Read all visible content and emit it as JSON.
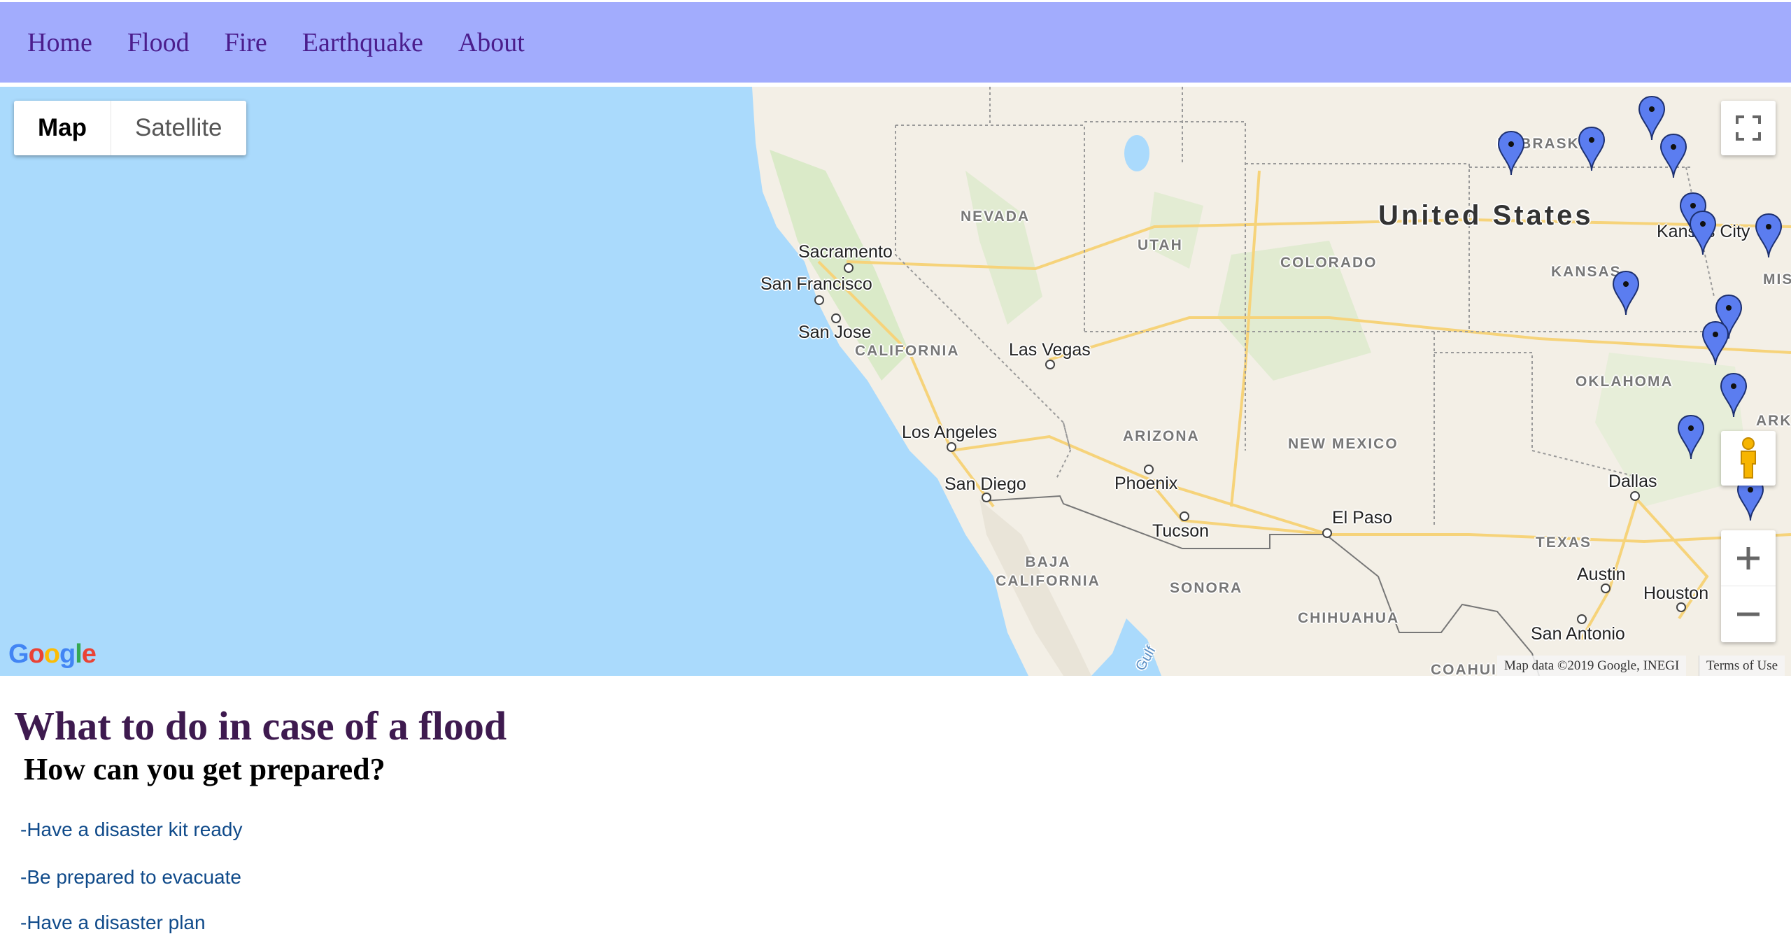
{
  "nav": {
    "items": [
      "Home",
      "Flood",
      "Fire",
      "Earthquake",
      "About"
    ]
  },
  "map": {
    "map_type": {
      "map": "Map",
      "satellite": "Satellite"
    },
    "labels": {
      "country": "United States",
      "states": [
        "NEBRASKA",
        "NEVADA",
        "UTAH",
        "COLORADO",
        "KANSAS",
        "MISSOU",
        "CALIFORNIA",
        "OKLAHOMA",
        "ARKANS",
        "ARIZONA",
        "NEW MEXICO",
        "TEXAS",
        "BAJA CALIFORNIA",
        "SONORA",
        "CHIHUAHUA",
        "COAHUI"
      ],
      "cities": [
        "Sacramento",
        "San Francisco",
        "San Jose",
        "Las Vegas",
        "Los Angeles",
        "San Diego",
        "Phoenix",
        "Tucson",
        "El Paso",
        "Kansas City",
        "Dallas",
        "Austin",
        "Houston",
        "San Antonio"
      ],
      "water": "Gulf"
    },
    "attribution": "Map data ©2019 Google, INEGI",
    "terms": "Terms of Use",
    "logo": "Google",
    "colors": {
      "water": "#aadafc",
      "land": "#f3efe6",
      "marker": "#5b7df0",
      "nav": "#a2acfd"
    },
    "icons": [
      "fullscreen-icon",
      "pegman-icon",
      "zoom-in-icon",
      "zoom-out-icon",
      "map-marker-icon"
    ]
  },
  "content": {
    "title": "What to do in case of a flood",
    "subtitle": "How can you get prepared?",
    "tips": [
      "-Have a disaster kit ready",
      "-Be prepared to evacuate",
      "-Have a disaster plan"
    ]
  }
}
